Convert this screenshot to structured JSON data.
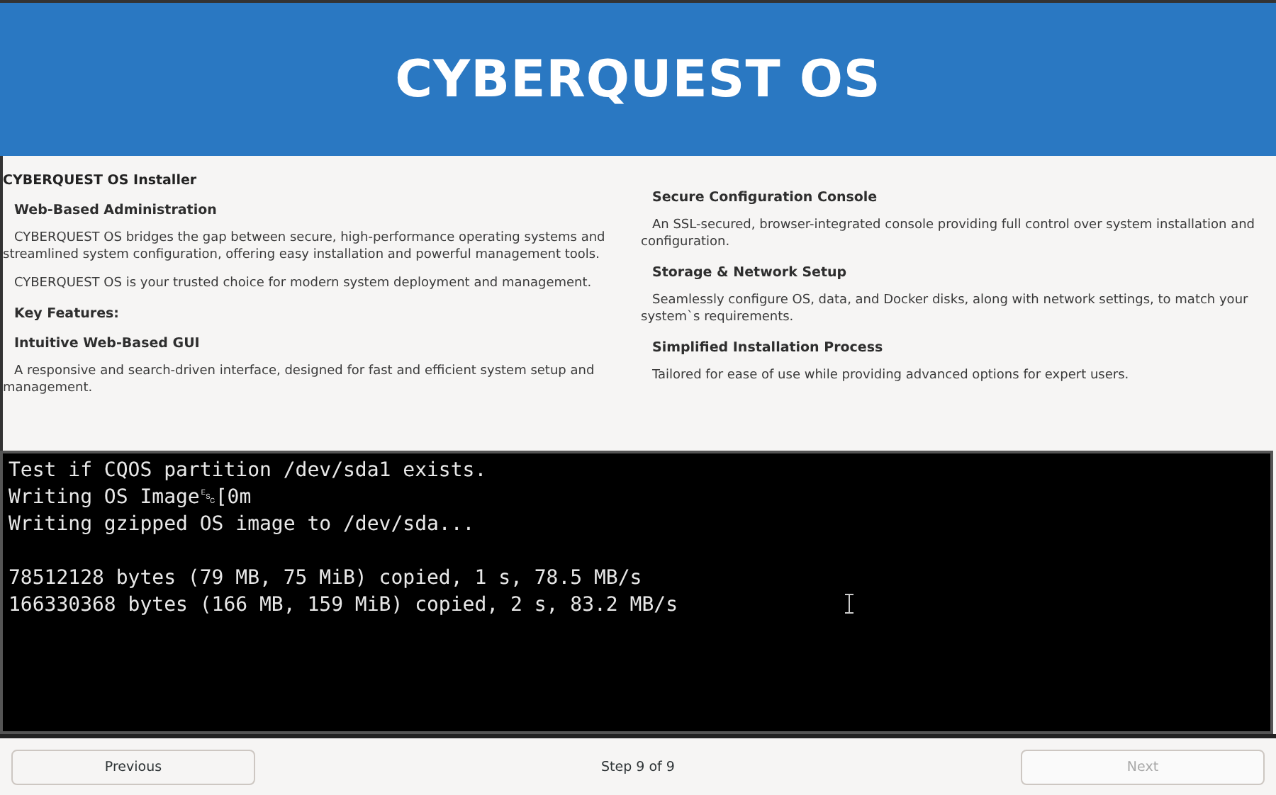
{
  "banner": {
    "title": "CYBERQUEST OS"
  },
  "columns": [
    {
      "items": [
        {
          "kind": "title",
          "text": "CYBERQUEST OS Installer"
        },
        {
          "kind": "heading",
          "text": "Web-Based Administration"
        },
        {
          "kind": "paragraph",
          "text": "CYBERQUEST OS bridges the gap between secure, high-performance operating systems and streamlined system configuration, offering easy installation and powerful management tools."
        },
        {
          "kind": "paragraph",
          "text": "CYBERQUEST OS is your trusted choice for modern system deployment and management."
        },
        {
          "kind": "heading",
          "text": "Key Features:"
        },
        {
          "kind": "heading",
          "text": "Intuitive Web-Based GUI"
        },
        {
          "kind": "paragraph",
          "text": "A responsive and search-driven interface, designed for fast and efficient system setup and management."
        }
      ]
    },
    {
      "items": [
        {
          "kind": "heading",
          "text": "Secure Configuration Console"
        },
        {
          "kind": "paragraph",
          "text": "An SSL-secured, browser-integrated console providing full control over system installation and configuration."
        },
        {
          "kind": "heading",
          "text": "Storage & Network Setup"
        },
        {
          "kind": "paragraph",
          "text": "Seamlessly configure OS, data, and Docker disks, along with network settings, to match your system`s requirements."
        },
        {
          "kind": "heading",
          "text": "Simplified Installation Process"
        },
        {
          "kind": "paragraph",
          "text": "Tailored for ease of use while providing advanced options for expert users."
        }
      ]
    }
  ],
  "terminal": {
    "blocks": [
      {
        "lines": [
          "Test if CQOS partition /dev/sda1 exists.",
          "Writing OS Image␛[0m",
          "Writing gzipped OS image to /dev/sda..."
        ]
      },
      {
        "lines": [
          "78512128 bytes (79 MB, 75 MiB) copied, 1 s, 78.5 MB/s",
          "166330368 bytes (166 MB, 159 MiB) copied, 2 s, 83.2 MB/s"
        ]
      }
    ]
  },
  "footer": {
    "previous": {
      "label": "Previous",
      "disabled": false
    },
    "step": "Step 9 of 9",
    "next": {
      "label": "Next",
      "disabled": true
    }
  }
}
